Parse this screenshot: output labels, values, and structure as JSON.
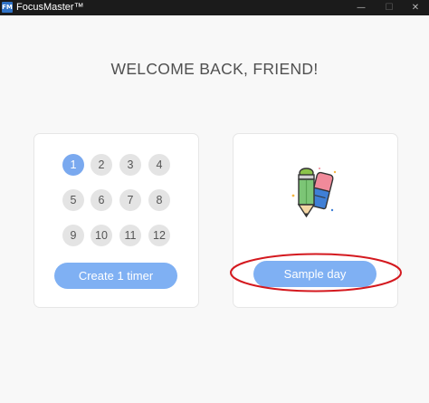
{
  "window": {
    "logo_text": "FM",
    "title": "FocusMaster™",
    "minimize_glyph": "—",
    "maximize_glyph": "☐",
    "close_glyph": "✕"
  },
  "welcome": {
    "heading": "WELCOME BACK, FRIEND!"
  },
  "timer_card": {
    "numbers": [
      "1",
      "2",
      "3",
      "4",
      "5",
      "6",
      "7",
      "8",
      "9",
      "10",
      "11",
      "12"
    ],
    "selected": "1",
    "create_button": "Create 1 timer"
  },
  "sample_card": {
    "illustration": "pencil-eraser-icon",
    "sample_button": "Sample day"
  },
  "colors": {
    "accent": "#7fb0f3",
    "selected_number": "#7aa9ef",
    "highlight_ellipse": "#d4191f"
  }
}
